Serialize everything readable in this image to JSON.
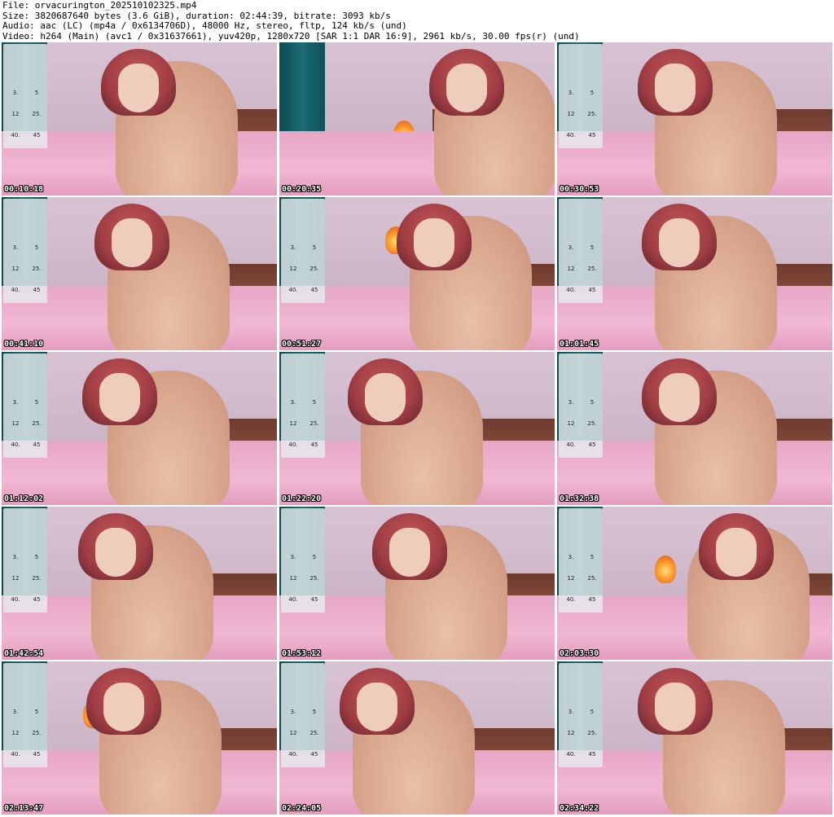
{
  "header": {
    "file_line": "File: orvacurington_202510102325.mp4",
    "size_line": "Size: 3820687640 bytes (3.6 GiB), duration: 02:44:39, bitrate: 3093 kb/s",
    "audio_line": "Audio: aac (LC) (mp4a / 0x6134706D), 48000 Hz, stereo, fltp, 124 kb/s (und)",
    "video_line": "Video: h264 (Main) (avc1 / 0x31637661), yuv420p, 1280x720 [SAR 1:1 DAR 16:9], 2961 kb/s, 30.00 fps(r) (und)"
  },
  "thumbnails": [
    {
      "timestamp": "00:10:18"
    },
    {
      "timestamp": "00:20:35"
    },
    {
      "timestamp": "00:30:53"
    },
    {
      "timestamp": "00:41:10"
    },
    {
      "timestamp": "00:51:27"
    },
    {
      "timestamp": "01:01:45"
    },
    {
      "timestamp": "01:12:02"
    },
    {
      "timestamp": "01:22:20"
    },
    {
      "timestamp": "01:32:38"
    },
    {
      "timestamp": "01:42:54"
    },
    {
      "timestamp": "01:53:12"
    },
    {
      "timestamp": "02:03:30"
    },
    {
      "timestamp": "02:13:47"
    },
    {
      "timestamp": "02:24:05"
    },
    {
      "timestamp": "02:34:22"
    }
  ],
  "overlay_menu": {
    "cells": [
      "3.",
      "5",
      "12",
      "25.",
      "40.",
      "45"
    ]
  },
  "colors": {
    "curtain": "#1c6b73",
    "wall": "#d8c3d3",
    "bedding": "#f0b8d3",
    "hair": "#a03c44",
    "lamp": "#ff9a2e"
  }
}
